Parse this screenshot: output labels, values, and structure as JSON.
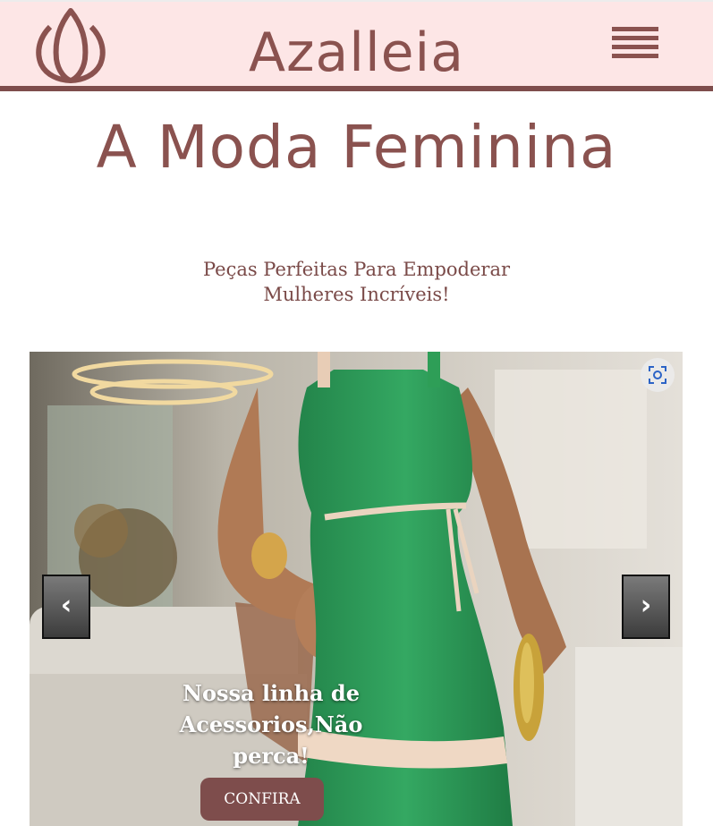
{
  "header": {
    "brand": "Azalleia",
    "logo_icon": "lotus-icon",
    "menu_icon": "hamburger-menu-icon"
  },
  "hero": {
    "title": "A Moda Feminina",
    "subtitle": "Peças Perfeitas Para Empoderar Mulheres Incríveis!"
  },
  "carousel": {
    "slide_caption": "Nossa linha de Acessorios,Não perca!",
    "cta_label": "CONFIRA",
    "prev_label": "‹",
    "next_label": "›",
    "lens_icon": "visual-search-icon"
  },
  "colors": {
    "brand": "#8a524f",
    "header_bg": "#fde6e6",
    "header_border": "#7e4d4c",
    "dress_green": "#2e9e57"
  }
}
